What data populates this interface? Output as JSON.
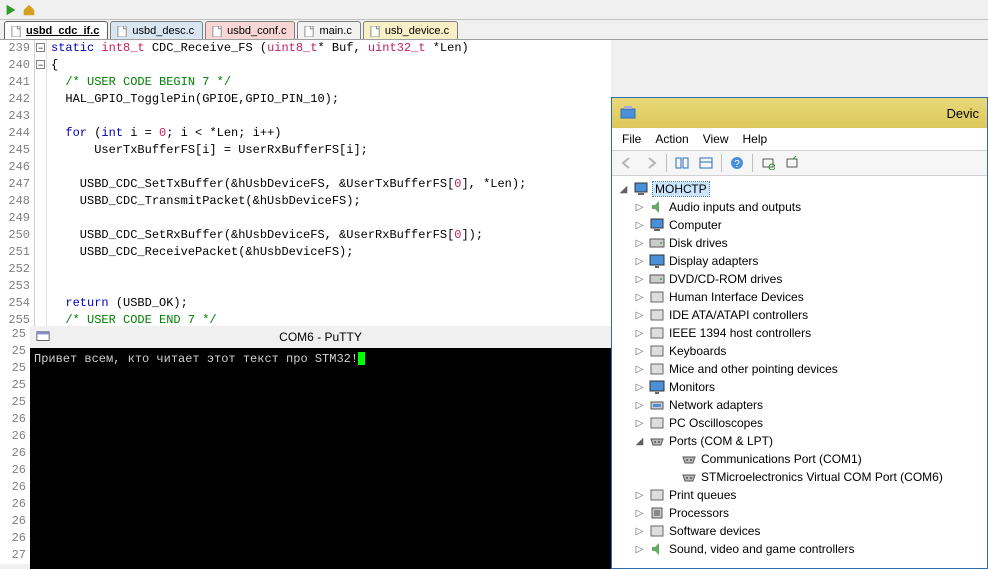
{
  "tabs": [
    {
      "label": "usbd_cdc_if.c",
      "cls": "active file-tab-default"
    },
    {
      "label": "usbd_desc.c",
      "cls": "file-tab-blue"
    },
    {
      "label": "usbd_conf.c",
      "cls": "file-tab-pink"
    },
    {
      "label": "main.c",
      "cls": "file-tab-default"
    },
    {
      "label": "usb_device.c",
      "cls": "file-tab-yellow"
    }
  ],
  "code_start_line": 239,
  "code": [
    {
      "t": "kw",
      "v": "static "
    },
    {
      "t": "ty",
      "v": "int8_t"
    },
    {
      "t": "",
      "v": " CDC_Receive_FS ("
    },
    {
      "t": "ty",
      "v": "uint8_t"
    },
    {
      "t": "",
      "v": "* Buf, "
    },
    {
      "t": "ty",
      "v": "uint32_t"
    },
    {
      "t": "",
      "v": " *Len)"
    }
  ],
  "lines": [
    {
      "n": 239,
      "fold": true,
      "html": "<span class='kw'>static</span> <span class='ty'>int8_t</span> CDC_Receive_FS (<span class='ty'>uint8_t</span>* Buf, <span class='ty'>uint32_t</span> *Len)"
    },
    {
      "n": 240,
      "fold": true,
      "html": "{"
    },
    {
      "n": 241,
      "html": "  <span class='cm'>/* USER CODE BEGIN 7 */</span>"
    },
    {
      "n": 242,
      "html": "  HAL_GPIO_TogglePin(GPIOE,GPIO_PIN_10);"
    },
    {
      "n": 243,
      "html": ""
    },
    {
      "n": 244,
      "html": "  <span class='kw'>for</span> (<span class='kw'>int</span> i = <span class='num'>0</span>; i &lt; *Len; i++)"
    },
    {
      "n": 245,
      "html": "      UserTxBufferFS[i] = UserRxBufferFS[i];"
    },
    {
      "n": 246,
      "html": ""
    },
    {
      "n": 247,
      "html": "    USBD_CDC_SetTxBuffer(&amp;hUsbDeviceFS, &amp;UserTxBufferFS[<span class='num'>0</span>], *Len);"
    },
    {
      "n": 248,
      "html": "    USBD_CDC_TransmitPacket(&amp;hUsbDeviceFS);"
    },
    {
      "n": 249,
      "html": ""
    },
    {
      "n": 250,
      "html": "    USBD_CDC_SetRxBuffer(&amp;hUsbDeviceFS, &amp;UserRxBufferFS[<span class='num'>0</span>]);"
    },
    {
      "n": 251,
      "html": "    USBD_CDC_ReceivePacket(&amp;hUsbDeviceFS);"
    },
    {
      "n": 252,
      "html": ""
    },
    {
      "n": 253,
      "html": ""
    },
    {
      "n": 254,
      "html": "  <span class='kw'>return</span> (USBD_OK);"
    },
    {
      "n": 255,
      "html": "  <span class='cm'>/* USER CODE END 7 */</span>"
    }
  ],
  "left_gutter_tail": [
    25,
    25,
    25,
    25,
    25,
    26,
    26,
    26,
    26,
    26,
    26,
    26,
    26,
    27
  ],
  "terminal": {
    "title": "COM6 - PuTTY",
    "line": "Привет всем, кто читает этот текст про STM32!"
  },
  "devmgr": {
    "title": "Devic",
    "menu": [
      "File",
      "Action",
      "View",
      "Help"
    ],
    "root": "МОНСТР",
    "nodes": [
      {
        "icon": "audio",
        "label": "Audio inputs and outputs",
        "exp": "▷"
      },
      {
        "icon": "computer",
        "label": "Computer",
        "exp": "▷"
      },
      {
        "icon": "disk",
        "label": "Disk drives",
        "exp": "▷"
      },
      {
        "icon": "display",
        "label": "Display adapters",
        "exp": "▷"
      },
      {
        "icon": "dvd",
        "label": "DVD/CD-ROM drives",
        "exp": "▷"
      },
      {
        "icon": "hid",
        "label": "Human Interface Devices",
        "exp": "▷"
      },
      {
        "icon": "ide",
        "label": "IDE ATA/ATAPI controllers",
        "exp": "▷"
      },
      {
        "icon": "ieee",
        "label": "IEEE 1394 host controllers",
        "exp": "▷"
      },
      {
        "icon": "kbd",
        "label": "Keyboards",
        "exp": "▷"
      },
      {
        "icon": "mouse",
        "label": "Mice and other pointing devices",
        "exp": "▷"
      },
      {
        "icon": "monitor",
        "label": "Monitors",
        "exp": "▷"
      },
      {
        "icon": "net",
        "label": "Network adapters",
        "exp": "▷"
      },
      {
        "icon": "osc",
        "label": "PC Oscilloscopes",
        "exp": "▷"
      },
      {
        "icon": "ports",
        "label": "Ports (COM & LPT)",
        "exp": "◢",
        "children": [
          {
            "icon": "port",
            "label": "Communications Port (COM1)"
          },
          {
            "icon": "port",
            "label": "STMicroelectronics Virtual COM Port (COM6)"
          }
        ]
      },
      {
        "icon": "print",
        "label": "Print queues",
        "exp": "▷"
      },
      {
        "icon": "cpu",
        "label": "Processors",
        "exp": "▷"
      },
      {
        "icon": "soft",
        "label": "Software devices",
        "exp": "▷"
      },
      {
        "icon": "sound",
        "label": "Sound, video and game controllers",
        "exp": "▷"
      }
    ]
  }
}
